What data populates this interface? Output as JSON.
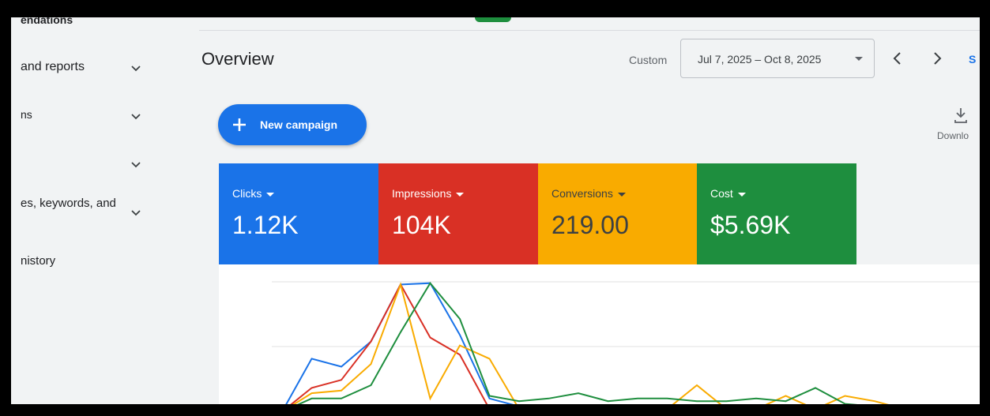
{
  "sidebar": {
    "items": [
      {
        "label": "endations",
        "chevron": false
      },
      {
        "label": "and reports",
        "chevron": true
      },
      {
        "label": "ns",
        "chevron": true
      },
      {
        "label": "",
        "chevron": true
      },
      {
        "label": "es, keywords, and",
        "chevron": true
      },
      {
        "label": "nistory",
        "chevron": false
      }
    ]
  },
  "header": {
    "title": "Overview",
    "date_preset": "Custom",
    "date_range": "Jul 7, 2025 – Oct 8, 2025",
    "cut_link": "S"
  },
  "actions": {
    "new_campaign": "New campaign",
    "download": "Downlo"
  },
  "metrics": [
    {
      "label": "Clicks",
      "value": "1.12K",
      "bg": "#1a73e8",
      "fg": "#ffffff"
    },
    {
      "label": "Impressions",
      "value": "104K",
      "bg": "#d93025",
      "fg": "#ffffff"
    },
    {
      "label": "Conversions",
      "value": "219.00",
      "bg": "#f9ab00",
      "fg": "#3c4043"
    },
    {
      "label": "Cost",
      "value": "$5.69K",
      "bg": "#1e8e3e",
      "fg": "#ffffff"
    }
  ],
  "chart_data": {
    "type": "line",
    "series": [
      {
        "color": "#1a73e8",
        "values": [
          0.02,
          0.42,
          0.36,
          0.55,
          0.98,
          0.99,
          0.6,
          0.12,
          0.06,
          0.03,
          0.03,
          0.03,
          0.03,
          0.03,
          0.03,
          0.03,
          0.03,
          0.03,
          0.03,
          0.03,
          0.03,
          0.03
        ]
      },
      {
        "color": "#d93025",
        "values": [
          0.02,
          0.2,
          0.26,
          0.55,
          0.98,
          0.58,
          0.45,
          0.04,
          0.04,
          0.04,
          0.04,
          0.04,
          0.04,
          0.04,
          0.04,
          0.04,
          0.04,
          0.04,
          0.04,
          0.04,
          0.04,
          0.04
        ]
      },
      {
        "color": "#f9ab00",
        "values": [
          0.02,
          0.16,
          0.18,
          0.38,
          0.98,
          0.12,
          0.52,
          0.42,
          0.04,
          0.03,
          0.04,
          0.04,
          0.03,
          0.04,
          0.22,
          0.04,
          0.04,
          0.14,
          0.04,
          0.14,
          0.1,
          0.04
        ]
      },
      {
        "color": "#1e8e3e",
        "values": [
          0.02,
          0.12,
          0.12,
          0.22,
          0.62,
          0.99,
          0.72,
          0.14,
          0.1,
          0.12,
          0.16,
          0.1,
          0.12,
          0.12,
          0.1,
          0.1,
          0.12,
          0.1,
          0.2,
          0.08,
          0.06,
          0.04
        ]
      }
    ]
  }
}
